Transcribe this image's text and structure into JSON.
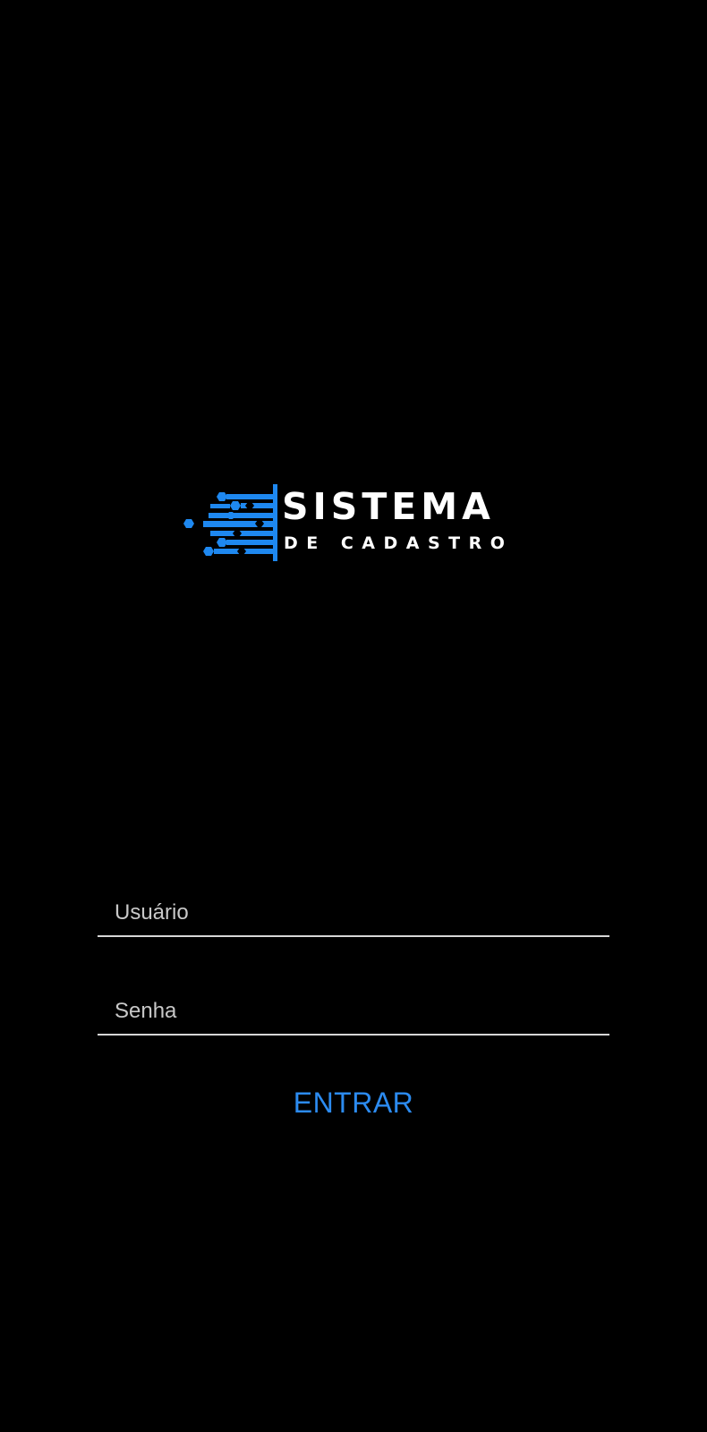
{
  "logo": {
    "title": "SISTEMA",
    "subtitle": "DE CADASTRO",
    "icon": "circuit-lines-icon",
    "accent_color": "#1e88f0",
    "text_color": "#ffffff"
  },
  "login_form": {
    "username": {
      "placeholder": "Usuário",
      "value": ""
    },
    "password": {
      "placeholder": "Senha",
      "value": ""
    },
    "submit_label": "ENTRAR",
    "submit_color": "#2c8bf0",
    "underline_color": "#d6d6d6"
  },
  "background_color": "#000000"
}
